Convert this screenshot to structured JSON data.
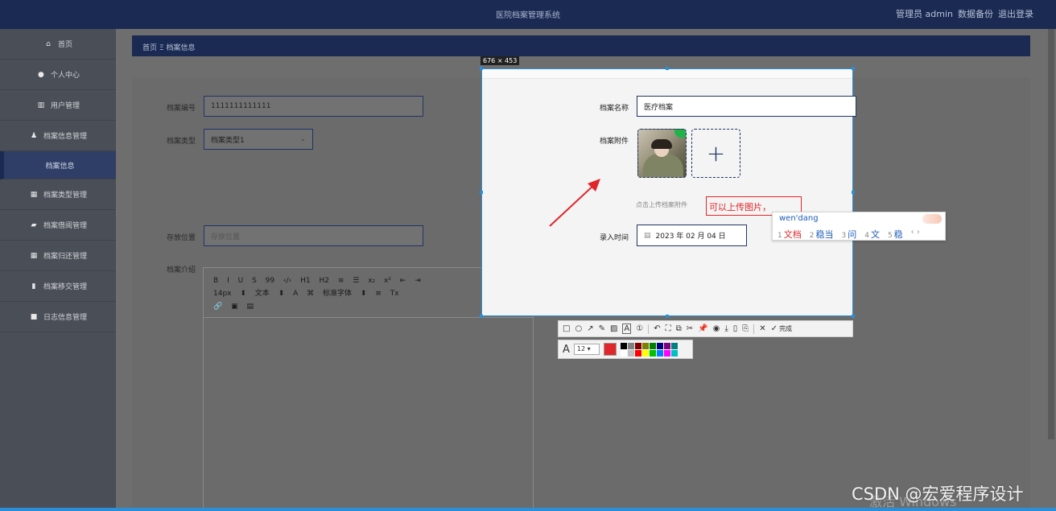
{
  "header": {
    "title": "医院档案管理系统",
    "user": "管理员 admin",
    "backup": "数据备份",
    "logout": "退出登录"
  },
  "sidebar": {
    "items": [
      {
        "icon": "home-icon",
        "glyph": "⌂",
        "label": "首页"
      },
      {
        "icon": "user-icon",
        "glyph": "●",
        "label": "个人中心"
      },
      {
        "icon": "columns-icon",
        "glyph": "▥",
        "label": "用户管理"
      },
      {
        "icon": "person-card-icon",
        "glyph": "♟",
        "label": "档案信息管理"
      },
      {
        "icon": "",
        "glyph": "",
        "label": "档案信息"
      },
      {
        "icon": "grid-icon",
        "glyph": "▦",
        "label": "档案类型管理"
      },
      {
        "icon": "briefcase-icon",
        "glyph": "▰",
        "label": "档案借阅管理"
      },
      {
        "icon": "grid-icon",
        "glyph": "▦",
        "label": "档案归还管理"
      },
      {
        "icon": "bar-chart-icon",
        "glyph": "▮",
        "label": "档案移交管理"
      },
      {
        "icon": "message-icon",
        "glyph": "■",
        "label": "日志信息管理"
      }
    ]
  },
  "breadcrumb": {
    "home": "首页",
    "sep": "Ξ",
    "current": "档案信息"
  },
  "form": {
    "code_label": "档案编号",
    "code_value": "1111111111111",
    "type_label": "档案类型",
    "type_value": "档案类型1",
    "location_label": "存放位置",
    "location_placeholder": "存放位置",
    "intro_label": "档案介绍",
    "name_label": "档案名称",
    "name_value": "医疗档案",
    "attach_label": "档案附件",
    "attach_hint": "点击上传档案附件",
    "time_label": "录入时间",
    "time_value": "2023 年 02 月 04 日"
  },
  "editor": {
    "row1": [
      "B",
      "I",
      "U",
      "S",
      "99",
      "‹/›",
      "H1",
      "H2",
      "≡",
      "☰",
      "x₂",
      "x²",
      "⇤",
      "⇥"
    ],
    "row2": [
      "14px",
      "⬍",
      "文本",
      "⬍",
      "A",
      "⌘",
      "标准字体",
      "⬍",
      "≡",
      "Tx"
    ],
    "row3": [
      "🔗",
      "▣",
      "▤"
    ]
  },
  "screenshot": {
    "dimensions": "676 × 453",
    "annotation": "可以上传图片，",
    "ime_pinyin": "wen'dang",
    "ime_candidates": [
      {
        "n": "1",
        "text": "文档"
      },
      {
        "n": "2",
        "text": "稳当"
      },
      {
        "n": "3",
        "text": "问"
      },
      {
        "n": "4",
        "text": "文"
      },
      {
        "n": "5",
        "text": "稳"
      }
    ],
    "ime_nav": "‹ ›",
    "tools": [
      "□",
      "○",
      "↗",
      "✎",
      "▨",
      "A",
      "①",
      "↶",
      "⛶",
      "⧉",
      "✂",
      "📌",
      "◉",
      "⤓",
      "▯",
      "⎘",
      "✕",
      "✓"
    ],
    "done": "完成",
    "font_glyph": "A",
    "font_size": "12",
    "active_color": "#e0262a",
    "palette": [
      "#000000",
      "#808080",
      "#800000",
      "#808000",
      "#008000",
      "#000080",
      "#800080",
      "#008080",
      "#ffffff",
      "#c0c0c0",
      "#ff0000",
      "#ffff00",
      "#00c000",
      "#0080ff",
      "#ff00ff",
      "#00c0c0"
    ]
  },
  "watermark": "CSDN @宏爱程序设计",
  "watermark_faint": "激活 Windows"
}
